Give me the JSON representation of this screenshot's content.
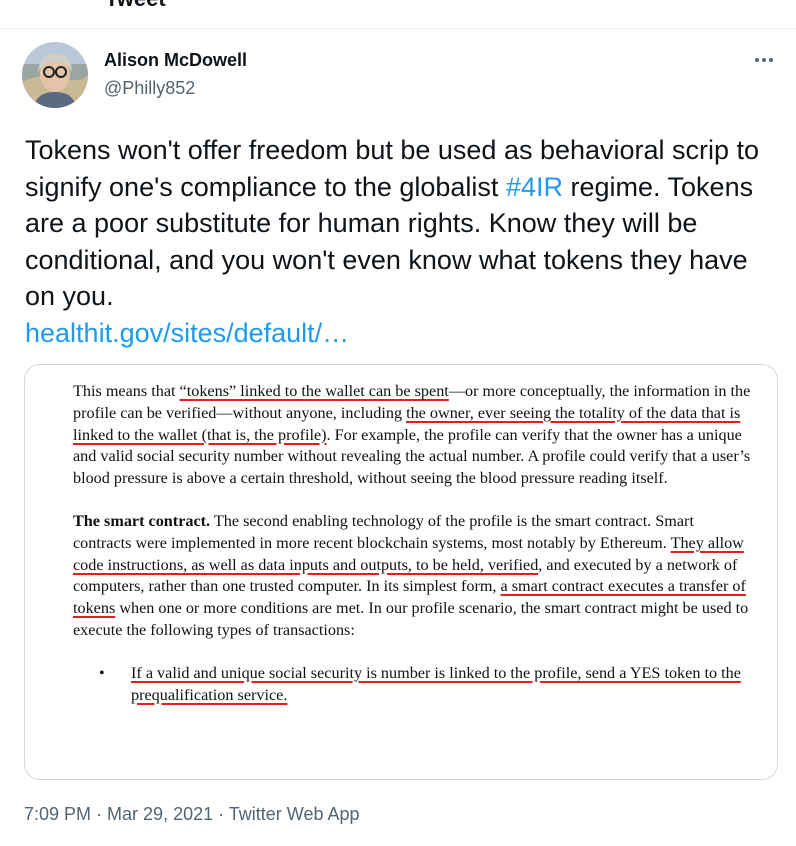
{
  "header": {
    "title": "Tweet"
  },
  "tweet": {
    "author": {
      "name": "Alison McDowell",
      "handle": "@Philly852"
    },
    "text": {
      "part1": "Tokens won't offer freedom but be used as behavioral scrip to signify one's compliance to the globalist ",
      "hashtag": "#4IR",
      "part2": " regime. Tokens are a poor substitute for human rights. Know they will be conditional, and you won't even know what tokens they have on you.",
      "link": "healthit.gov/sites/default/…"
    },
    "media": {
      "para1": {
        "a": "This means that ",
        "u1": "“tokens” linked to the wallet can be spent",
        "b": "—or more conceptually, the information in the profile can be verified—without anyone, including ",
        "u2": "the owner, ever seeing the totality of the data that is linked to the wallet (that is, the profile)",
        "c": ". For example, the profile can verify that the owner has a unique and valid social security number without revealing the actual number. A profile could verify that a user’s blood pressure is above a certain threshold, without seeing the blood pressure reading itself."
      },
      "para2": {
        "heading": "The smart contract.",
        "a": " The second enabling technology of the profile is the smart contract. Smart contracts were implemented in more recent blockchain systems, most notably by Ethereum. ",
        "u1": "They allow code instructions, as well as data inputs and outputs, to be held, verified",
        "b": ", and executed by a network of computers, rather than one trusted computer. In its simplest form, ",
        "u2": "a smart contract executes a transfer of tokens",
        "c": " when one or more conditions are met. In our profile scenario, the smart contract might be used to execute the following types of transactions:"
      },
      "bullet": {
        "marker": "•",
        "u1": "If a valid and unique social security is number is linked to the profile, send a YES token to the prequalification service."
      }
    },
    "footer": {
      "time": "7:09 PM",
      "sep1": " · ",
      "date": "Mar 29, 2021",
      "sep2": " · ",
      "source": "Twitter Web App"
    }
  },
  "colors": {
    "link": "#1d9bf0",
    "underline": "#e0201c",
    "secondary": "#536471"
  },
  "icons": {
    "more": "more-horizontal-icon"
  }
}
